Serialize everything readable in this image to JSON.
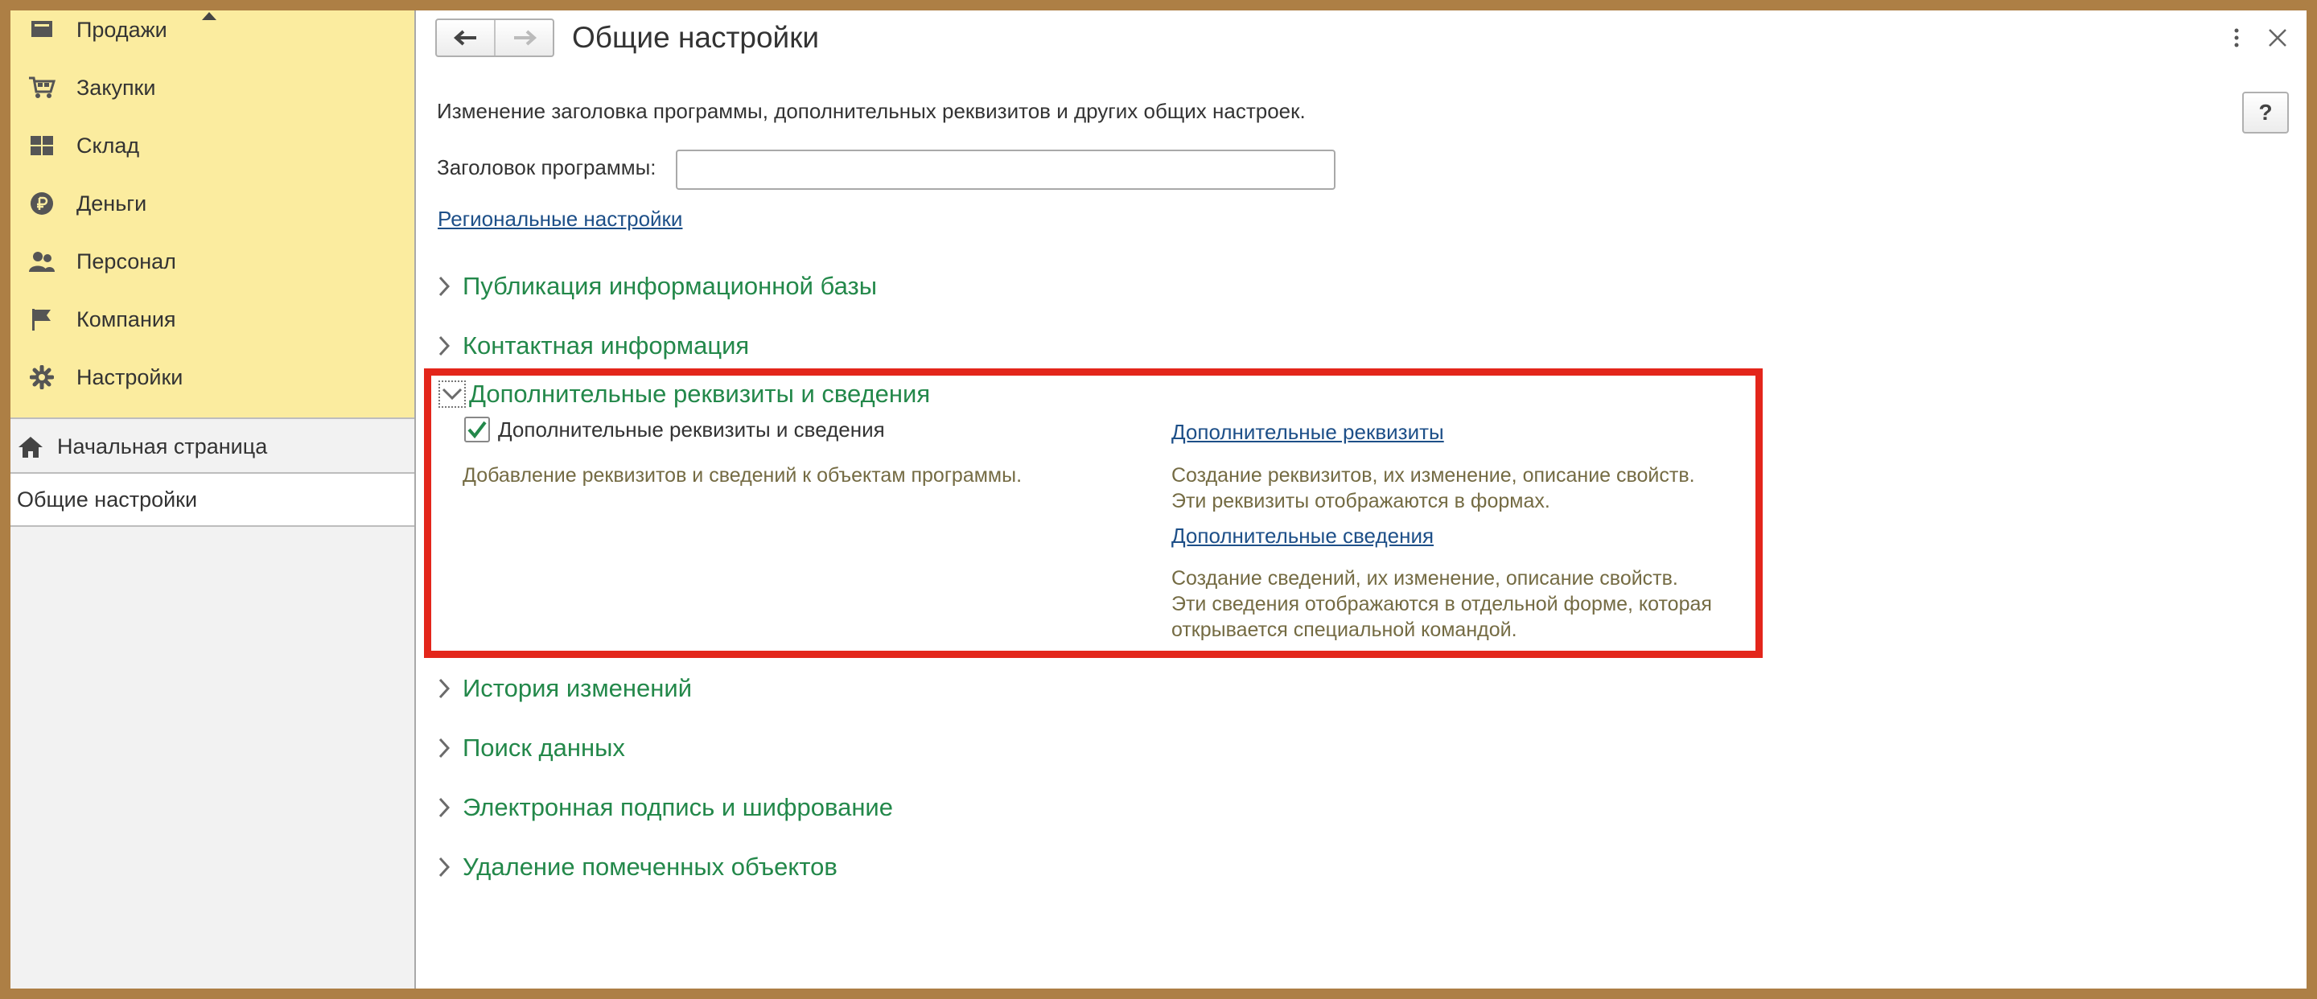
{
  "sidebar": {
    "sections": [
      {
        "label": "Продажи",
        "icon": "sales-icon"
      },
      {
        "label": "Закупки",
        "icon": "cart-icon"
      },
      {
        "label": "Склад",
        "icon": "warehouse-icon"
      },
      {
        "label": "Деньги",
        "icon": "ruble-icon"
      },
      {
        "label": "Персонал",
        "icon": "people-icon"
      },
      {
        "label": "Компания",
        "icon": "flag-icon"
      },
      {
        "label": "Настройки",
        "icon": "gear-icon"
      }
    ],
    "nav": [
      {
        "label": "Начальная страница",
        "icon": "home-icon"
      },
      {
        "label": "Общие настройки"
      }
    ]
  },
  "main": {
    "title": "Общие настройки",
    "description": "Изменение заголовка программы, дополнительных реквизитов и других общих настроек.",
    "help_label": "?",
    "program_title_label": "Заголовок программы:",
    "program_title_value": "",
    "regional_link": "Региональные настройки",
    "groups_before": [
      "Публикация информационной базы",
      "Контактная информация"
    ],
    "expanded_group": {
      "title": "Дополнительные реквизиты и сведения",
      "checkbox_label": "Дополнительные реквизиты и сведения",
      "checkbox_checked": true,
      "checkbox_hint": "Добавление реквизитов и сведений к объектам программы.",
      "links": [
        {
          "label": "Дополнительные реквизиты",
          "hint_lines": [
            "Создание реквизитов, их изменение, описание свойств.",
            "Эти реквизиты отображаются в формах."
          ]
        },
        {
          "label": "Дополнительные сведения",
          "hint_lines": [
            "Создание сведений, их изменение, описание свойств.",
            "Эти сведения отображаются в отдельной форме, которая",
            "открывается специальной командой."
          ]
        }
      ]
    },
    "groups_after": [
      "История изменений",
      "Поиск данных",
      "Электронная подпись и шифрование",
      "Удаление помеченных объектов"
    ]
  },
  "colors": {
    "accent_green": "#23884a",
    "link_blue": "#1d4f88",
    "highlight_red": "#e3261b",
    "sections_bg": "#fbec9f",
    "frame_border": "#ad7f45"
  }
}
